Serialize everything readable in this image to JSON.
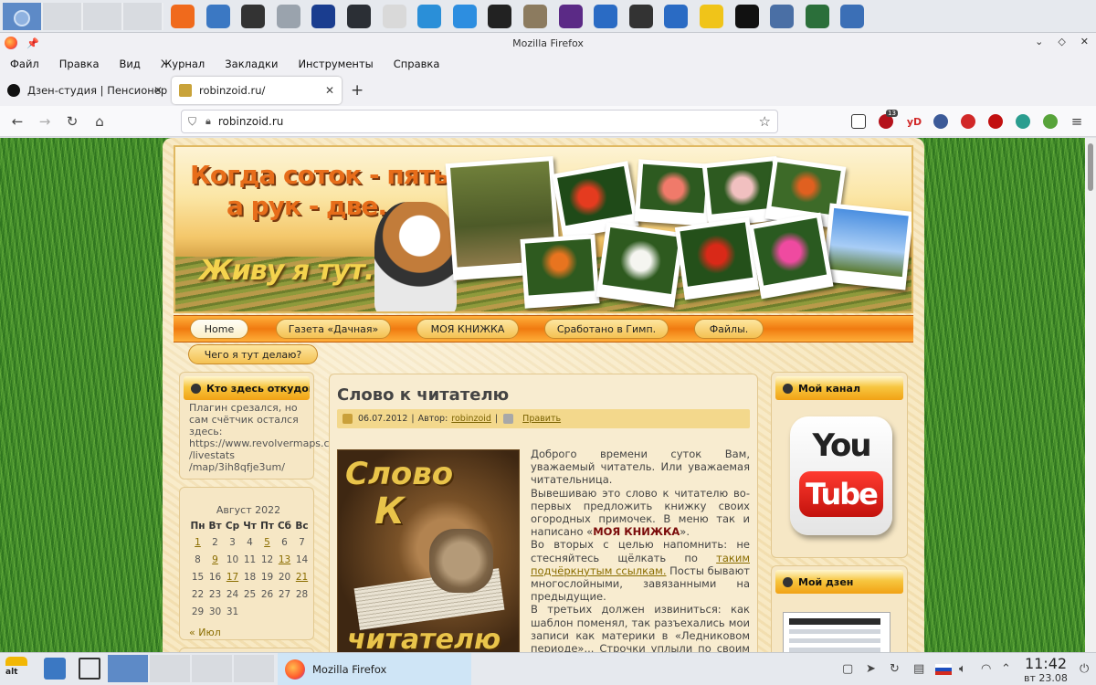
{
  "top_panel": {
    "launchers": [
      {
        "icon": "firefox-icon",
        "color": "#f06a1c"
      },
      {
        "icon": "folder-icon",
        "color": "#3b78c3"
      },
      {
        "icon": "terminal-icon",
        "color": "#333333"
      },
      {
        "icon": "more-icon",
        "color": "#9aa3ad"
      },
      {
        "icon": "video-editor-icon",
        "color": "#1a3d8f"
      },
      {
        "icon": "disc-icon",
        "color": "#2b2f35"
      },
      {
        "icon": "text-editor-icon",
        "color": "#d9d9d9"
      },
      {
        "icon": "calculator-icon",
        "color": "#2a8fd8"
      },
      {
        "icon": "document-icon",
        "color": "#2d8ee0"
      },
      {
        "icon": "soccer-icon",
        "color": "#222222"
      },
      {
        "icon": "gimp-icon",
        "color": "#8c7b5f"
      },
      {
        "icon": "media-icon",
        "color": "#5b2a86"
      },
      {
        "icon": "headphones-icon",
        "color": "#2a6bc4"
      },
      {
        "icon": "film-icon",
        "color": "#333333"
      },
      {
        "icon": "network-icon",
        "color": "#2a6bc4"
      },
      {
        "icon": "notes-icon",
        "color": "#f0c419"
      },
      {
        "icon": "amazon-icon",
        "color": "#111111"
      },
      {
        "icon": "webcam-icon",
        "color": "#4a6fa5"
      },
      {
        "icon": "globe-icon",
        "color": "#2b6f3a"
      },
      {
        "icon": "p-icon",
        "color": "#3b6fb6"
      }
    ]
  },
  "window": {
    "title": "Mozilla Firefox",
    "menu": [
      "Файл",
      "Правка",
      "Вид",
      "Журнал",
      "Закладки",
      "Инструменты",
      "Справка"
    ],
    "tabs": [
      {
        "label": "Дзен-студия | Пенсионер",
        "active": false
      },
      {
        "label": "robinzoid.ru/",
        "active": true
      }
    ],
    "url": "robinzoid.ru",
    "extension_badge": "13",
    "extension_text": "yD"
  },
  "site": {
    "banner": {
      "line1": "Когда соток - пять,",
      "line2": "а рук - две...",
      "line3": "Живу я тут..."
    },
    "nav": [
      "Home",
      "Газета «Дачная»",
      "МОЯ КНИЖКА",
      "Сработано в Гимп.",
      "Файлы.",
      "Чего я тут делаю?"
    ],
    "left": {
      "box1_title": "Кто здесь откудова...",
      "box1_lines": [
        "Плагин срезался, но",
        "сам счётчик остался",
        "здесь:",
        "https://www.revolvermaps.cc",
        "/livestats",
        "/map/3ih8qfje3um/"
      ],
      "calendar": {
        "month": "Август 2022",
        "weekdays": [
          "Пн",
          "Вт",
          "Ср",
          "Чт",
          "Пт",
          "Сб",
          "Вс"
        ],
        "rows": [
          [
            "1",
            "2",
            "3",
            "4",
            "5",
            "6",
            "7"
          ],
          [
            "8",
            "9",
            "10",
            "11",
            "12",
            "13",
            "14"
          ],
          [
            "15",
            "16",
            "17",
            "18",
            "19",
            "20",
            "21"
          ],
          [
            "22",
            "23",
            "24",
            "25",
            "26",
            "27",
            "28"
          ],
          [
            "29",
            "30",
            "31",
            "",
            "",
            "",
            ""
          ]
        ],
        "links": [
          "1",
          "5",
          "9",
          "13",
          "17",
          "21"
        ],
        "prev": "« Июл"
      }
    },
    "post": {
      "title": "Слово к читателю",
      "date": "06.07.2012",
      "author_label": "Автор:",
      "author": "robinzoid",
      "edit": "Править",
      "image_words": [
        "Слово",
        "К",
        "читателю"
      ],
      "p1": "Доброго времени суток Вам, уважаемый читатель. Или уважаемая читательница.",
      "p2_before": "Вывешиваю это слово к читателю во-первых предложить книжку своих огородных примочек. В меню так и написано «",
      "p2_bold": "МОЯ КНИЖКА",
      "p2_after": "».",
      "p3_before": "Во вторых с целью напомнить: не стесняйтесь щёлкать по ",
      "p3_link": "таким подчёркнутым ссылкам.",
      "p3_after": " Посты бывают многослойными, завязанными на предыдущие.",
      "p4": "В третьих должен извиниться: как шаблон поменял, так разъехались мои записи как материки в «Ледниковом периоде»... Строчки уплыли по своим соображениям."
    },
    "right": {
      "box1_title": "Мой канал",
      "yt_you": "You",
      "yt_tube": "Tube",
      "box2_title": "Мой дзен"
    }
  },
  "taskbar": {
    "task_label": "Mozilla Firefox",
    "start_label": "alt",
    "time": "11:42",
    "date": "вт 23.08"
  }
}
